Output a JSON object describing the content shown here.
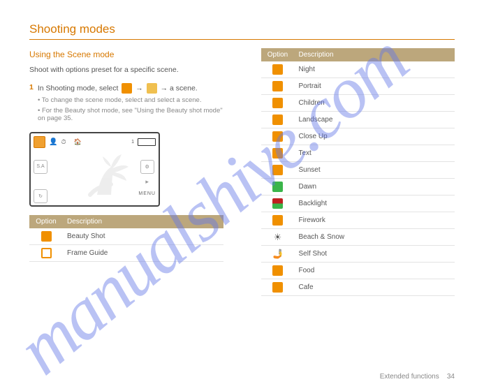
{
  "title": "Shooting modes",
  "left": {
    "heading": "Using the Scene mode",
    "paragraph": "Shoot with options preset for a specific scene.",
    "step1_num": "1",
    "step1_text": "In Shooting mode, select",
    "step1_arrow": "→",
    "step1_end": "a scene.",
    "step1_note": "To change the scene mode, select       and select a scene.",
    "step1_note2": "For the Beauty shot mode, see \"Using the Beauty shot mode\" on page 35.",
    "tableHeader1": "Option",
    "tableHeader2": "Description",
    "rows": [
      {
        "name": "scene-beauty",
        "label": "Beauty Shot"
      },
      {
        "name": "scene-frame",
        "label": "Frame Guide"
      }
    ]
  },
  "right": {
    "tableHeader1": "Option",
    "tableHeader2": "Description",
    "rows": [
      {
        "name": "scene-night",
        "label": "Night"
      },
      {
        "name": "scene-portrait",
        "label": "Portrait"
      },
      {
        "name": "scene-children",
        "label": "Children"
      },
      {
        "name": "scene-landscape",
        "label": "Landscape"
      },
      {
        "name": "scene-closeup",
        "label": "Close Up"
      },
      {
        "name": "scene-text",
        "label": "Text"
      },
      {
        "name": "scene-sunset",
        "label": "Sunset"
      },
      {
        "name": "scene-dawn",
        "label": "Dawn"
      },
      {
        "name": "scene-backlight",
        "label": "Backlight"
      },
      {
        "name": "scene-firework",
        "label": "Firework"
      },
      {
        "name": "scene-beach",
        "label": "Beach & Snow"
      },
      {
        "name": "scene-self",
        "label": "Self Shot"
      },
      {
        "name": "scene-food",
        "label": "Food"
      },
      {
        "name": "scene-cafe",
        "label": "Cafe"
      }
    ]
  },
  "footer": {
    "left": "Extended functions",
    "page": "34"
  },
  "watermark": "manualshive.com"
}
